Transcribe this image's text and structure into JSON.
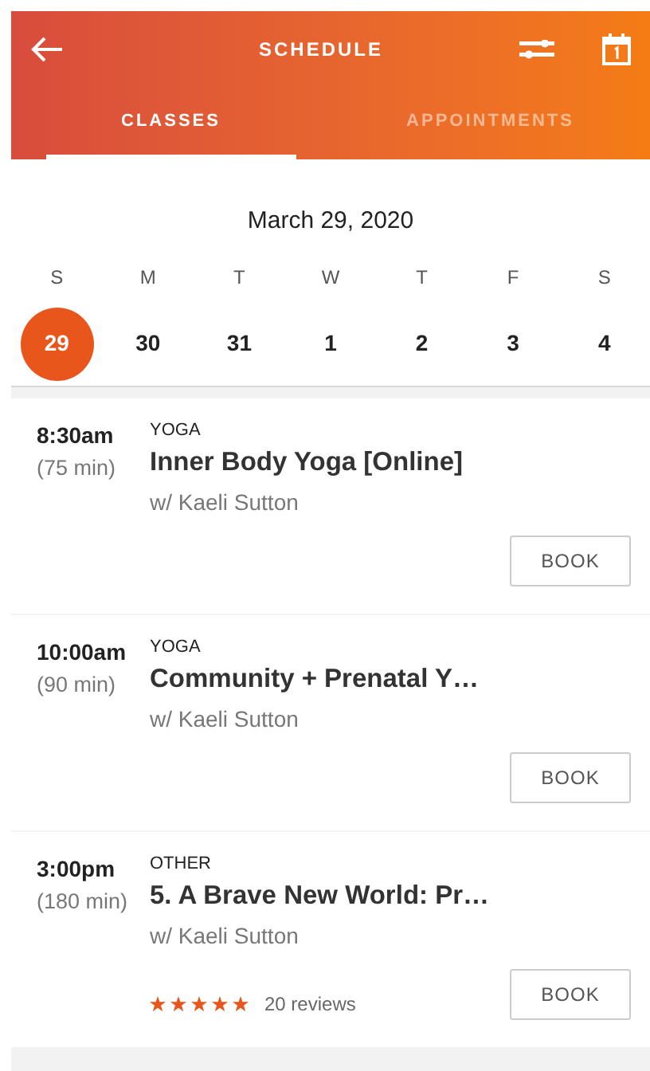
{
  "header": {
    "title": "SCHEDULE"
  },
  "tabs": [
    {
      "label": "CLASSES",
      "selected": true
    },
    {
      "label": "APPOINTMENTS",
      "selected": false
    }
  ],
  "date_heading": "March 29, 2020",
  "week": [
    {
      "weekday": "S",
      "day": "29",
      "selected": true
    },
    {
      "weekday": "M",
      "day": "30",
      "selected": false
    },
    {
      "weekday": "T",
      "day": "31",
      "selected": false
    },
    {
      "weekday": "W",
      "day": "1",
      "selected": false
    },
    {
      "weekday": "T",
      "day": "2",
      "selected": false
    },
    {
      "weekday": "F",
      "day": "3",
      "selected": false
    },
    {
      "weekday": "S",
      "day": "4",
      "selected": false
    }
  ],
  "classes": [
    {
      "time": "8:30am",
      "duration": "(75 min)",
      "category": "YOGA",
      "name": "Inner Body Yoga [Online]",
      "instructor": "w/ Kaeli Sutton",
      "button": "BOOK"
    },
    {
      "time": "10:00am",
      "duration": "(90 min)",
      "category": "YOGA",
      "name": "Community + Prenatal Y…",
      "instructor": "w/ Kaeli Sutton",
      "button": "BOOK"
    },
    {
      "time": "3:00pm",
      "duration": "(180 min)",
      "category": "OTHER",
      "name": "5. A Brave New World: Pr…",
      "instructor": "w/ Kaeli Sutton",
      "button": "BOOK",
      "stars": 5,
      "reviews": "20 reviews"
    }
  ]
}
